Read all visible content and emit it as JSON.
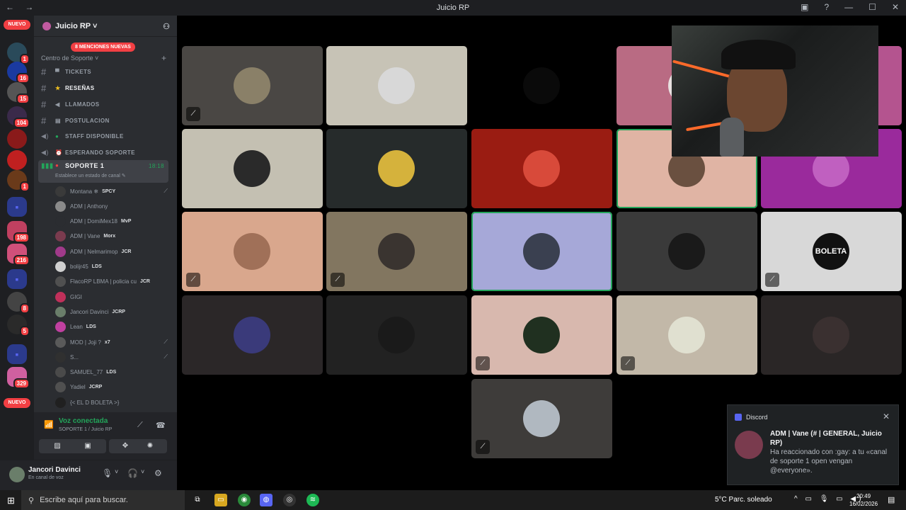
{
  "window": {
    "title": "Juicio RP",
    "nav_arrows": "← →",
    "controls": [
      "▣",
      "?",
      "—",
      "☐",
      "✕"
    ]
  },
  "server_bar": {
    "new_top": "NUEVO",
    "new_bottom": "NUEVO",
    "badges": [
      "1",
      "16",
      "15",
      "104",
      "1",
      "198",
      "216",
      "8",
      "5",
      "329"
    ],
    "folder_icon": "▪"
  },
  "guild": {
    "name": "Juicio RP ˅",
    "mentions_pill": "8 MENCIONES NUEVAS",
    "category": "Centro de Soporte ˅",
    "category_plus": "+",
    "channels": [
      {
        "icon": "#",
        "emoji": "▀",
        "name": "TICKETS"
      },
      {
        "icon": "#",
        "emoji": "★",
        "name": "RESEÑAS"
      },
      {
        "icon": "#",
        "emoji": "◀",
        "name": "LLAMADOS"
      },
      {
        "icon": "#",
        "emoji": "▤",
        "name": "POSTULACION"
      },
      {
        "icon": "◀)",
        "emoji": "●",
        "name": "STAFF DISPONIBLE"
      },
      {
        "icon": "◀)",
        "emoji": "⏰",
        "name": "ESPERANDO SOPORTE"
      }
    ],
    "active_voice": {
      "name": "SOPORTE 1",
      "time": "18:18",
      "status_hint": "Establece un estado de canal ✎"
    }
  },
  "voice_members": [
    {
      "name": "Montana ❄",
      "tag": "SPCY",
      "muted": true,
      "color": "#3a3a3a"
    },
    {
      "name": "ADM | Anthony",
      "tag": "",
      "muted": false,
      "color": "#8a8a8a"
    },
    {
      "name": "ADM | DomiMex18",
      "tag": "MvP",
      "muted": false,
      "color": "#2b2d31"
    },
    {
      "name": "ADM | Vane",
      "tag": "Morx",
      "muted": false,
      "color": "#7a3b4e"
    },
    {
      "name": "ADM | Nelmarimop",
      "tag": "JCR",
      "muted": false,
      "color": "#a03a8a"
    },
    {
      "name": "bolijr45",
      "tag": "LDS",
      "muted": false,
      "color": "#d0d0d0"
    },
    {
      "name": "FlacoRP LBMA | policia cu",
      "tag": "JCR",
      "muted": false,
      "color": "#505050"
    },
    {
      "name": "GIGI",
      "tag": "",
      "muted": false,
      "color": "#c0305a"
    },
    {
      "name": "Jancori Davinci",
      "tag": "JCRP",
      "muted": false,
      "color": "#6a7e6a"
    },
    {
      "name": "Lean",
      "tag": "LDS",
      "muted": false,
      "color": "#c040a0"
    },
    {
      "name": "MOD | Joji ?",
      "tag": "x7",
      "muted": true,
      "color": "#5a5a5a"
    },
    {
      "name": "S...",
      "tag": "",
      "muted": true,
      "color": "#303030"
    },
    {
      "name": "SAMUEL_77",
      "tag": "LDS",
      "muted": false,
      "color": "#4a4a4a"
    },
    {
      "name": "Yadiel",
      "tag": "JCRP",
      "muted": false,
      "color": "#505050"
    },
    {
      "name": "{< EL D BOLETA >}",
      "tag": "",
      "muted": false,
      "color": "#202020"
    }
  ],
  "voice_panel": {
    "status": "Voz conectada",
    "sub": "SOPORTE 1 / Juicio RP",
    "buttons": [
      "▨",
      "▣",
      "✥",
      "✺"
    ]
  },
  "user_panel": {
    "name": "Jancori Davinci",
    "status": "En canal de voz",
    "controls": [
      "🎙",
      "˅",
      "🎧",
      "˅",
      "⚙"
    ]
  },
  "tiles": [
    {
      "bg": "#4a4744",
      "av": "#8a8068",
      "muted": true,
      "speaking": false
    },
    {
      "bg": "#c7c3b6",
      "av": "#d8d8d8",
      "muted": false,
      "speaking": false
    },
    {
      "bg": "#000000",
      "av": "#0a0a0a",
      "muted": false,
      "speaking": false
    },
    {
      "bg": "#b96b83",
      "av": "#e8e0e0",
      "muted": false,
      "speaking": false
    },
    {
      "bg": "#b4548f",
      "av": "#9b3e7a",
      "muted": false,
      "speaking": false
    },
    {
      "bg": "#c4c0b2",
      "av": "#2a2a2a",
      "muted": false,
      "speaking": false
    },
    {
      "bg": "#262b2b",
      "av": "#d5b23c",
      "muted": false,
      "speaking": false
    },
    {
      "bg": "#9a1c12",
      "av": "#d84a3a",
      "muted": false,
      "speaking": false
    },
    {
      "bg": "#e0b4a4",
      "av": "#6a5040",
      "muted": false,
      "speaking": true
    },
    {
      "bg": "#9a2a9c",
      "av": "#c060c0",
      "muted": false,
      "speaking": false
    },
    {
      "bg": "#d9a78d",
      "av": "#a07058",
      "muted": true,
      "speaking": false
    },
    {
      "bg": "#827660",
      "av": "#3a3430",
      "muted": true,
      "speaking": false
    },
    {
      "bg": "#a6a8d8",
      "av": "#3a4050",
      "muted": false,
      "speaking": true
    },
    {
      "bg": "#3a3a3a",
      "av": "#1a1a1a",
      "muted": false,
      "speaking": false
    },
    {
      "bg": "#d8d8d8",
      "av": "#111111",
      "muted": true,
      "speaking": false
    },
    {
      "bg": "#2b2728",
      "av": "#3a3a7a",
      "muted": false,
      "speaking": false
    },
    {
      "bg": "#222222",
      "av": "#1a1a1a",
      "muted": false,
      "speaking": false
    },
    {
      "bg": "#d8b8ae",
      "av": "#203020",
      "muted": true,
      "speaking": false
    },
    {
      "bg": "#c2b8a8",
      "av": "#e0e0d0",
      "muted": true,
      "speaking": false
    },
    {
      "bg": "#2a2626",
      "av": "#3a3030",
      "muted": false,
      "speaking": false
    },
    {
      "bg": "#3e3c3a",
      "av": "#b0b8c0",
      "muted": true,
      "speaking": false
    }
  ],
  "tile_labels": {
    "boleta": "BOLETA"
  },
  "toast": {
    "app": "Discord",
    "title": "ADM | Vane (#  | GENERAL, Juicio RP)",
    "body": "Ha reaccionado con :gay: a tu «canal de soporte 1 open vengan @everyone».",
    "close": "✕"
  },
  "taskbar": {
    "search_placeholder": "Escribe aquí para buscar.",
    "weather": "5°C  Parc. soleado",
    "time": "20:49",
    "date": "16/02/2026",
    "tray": "^ ▭ 🎙 ▭ ◀)"
  }
}
